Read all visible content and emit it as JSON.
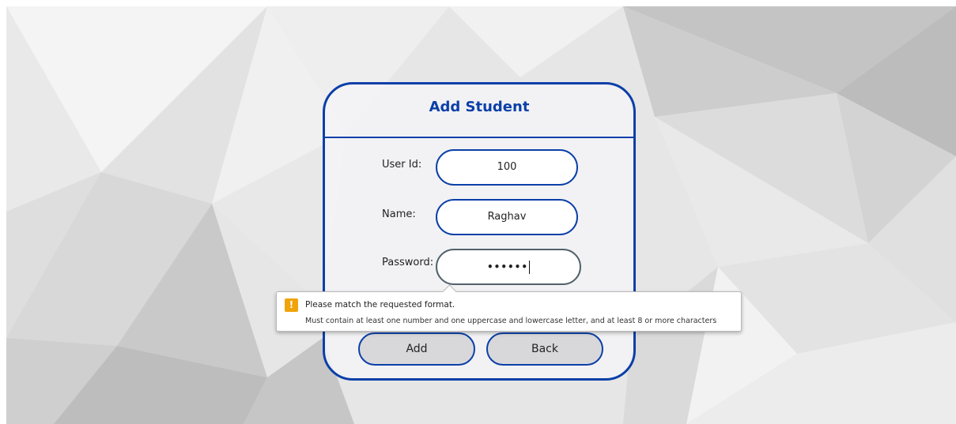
{
  "form": {
    "title": "Add Student",
    "user_id_label": "User Id:",
    "user_id_value": "100",
    "name_label": "Name:",
    "name_value": "Raghav",
    "password_label": "Password:",
    "password_masked": "••••••",
    "add_label": "Add",
    "back_label": "Back"
  },
  "tooltip": {
    "message": "Please match the requested format.",
    "detail": "Must contain at least one number and one uppercase and lowercase letter, and at least 8 or more characters",
    "icon": "warning-icon",
    "icon_glyph": "!"
  },
  "colors": {
    "accent": "#0b3fa8",
    "warning": "#f0a30a",
    "focused_border": "#52626b"
  }
}
